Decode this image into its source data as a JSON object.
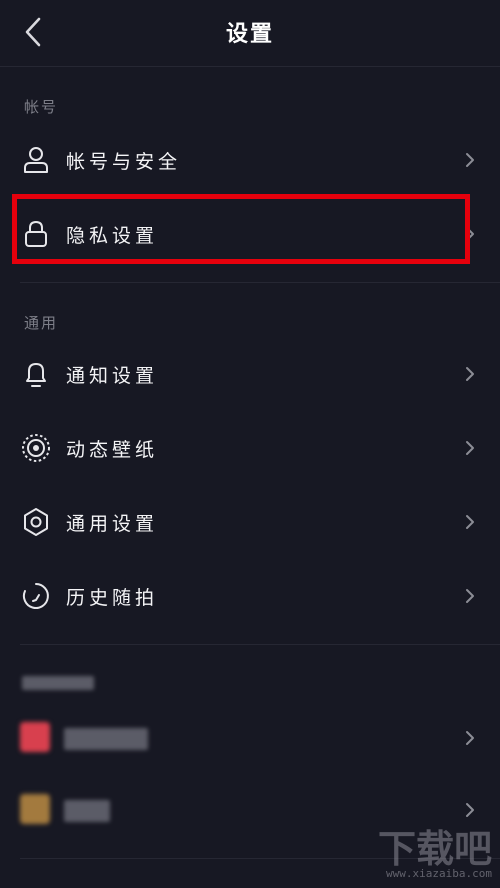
{
  "header": {
    "title": "设置"
  },
  "account_section": {
    "title": "帐号",
    "items": [
      {
        "label": "帐号与安全",
        "icon": "person-icon"
      },
      {
        "label": "隐私设置",
        "icon": "lock-icon"
      }
    ]
  },
  "general_section": {
    "title": "通用",
    "items": [
      {
        "label": "通知设置",
        "icon": "bell-icon"
      },
      {
        "label": "动态壁纸",
        "icon": "wallpaper-icon"
      },
      {
        "label": "通用设置",
        "icon": "gear-icon"
      },
      {
        "label": "历史随拍",
        "icon": "history-icon"
      }
    ]
  },
  "colors": {
    "background": "#171823",
    "highlight": "#e5000c",
    "divider": "#262733",
    "section_text": "#7d7e88"
  },
  "watermark": {
    "main": "下载吧",
    "sub": "www.xiazaiba.com"
  }
}
